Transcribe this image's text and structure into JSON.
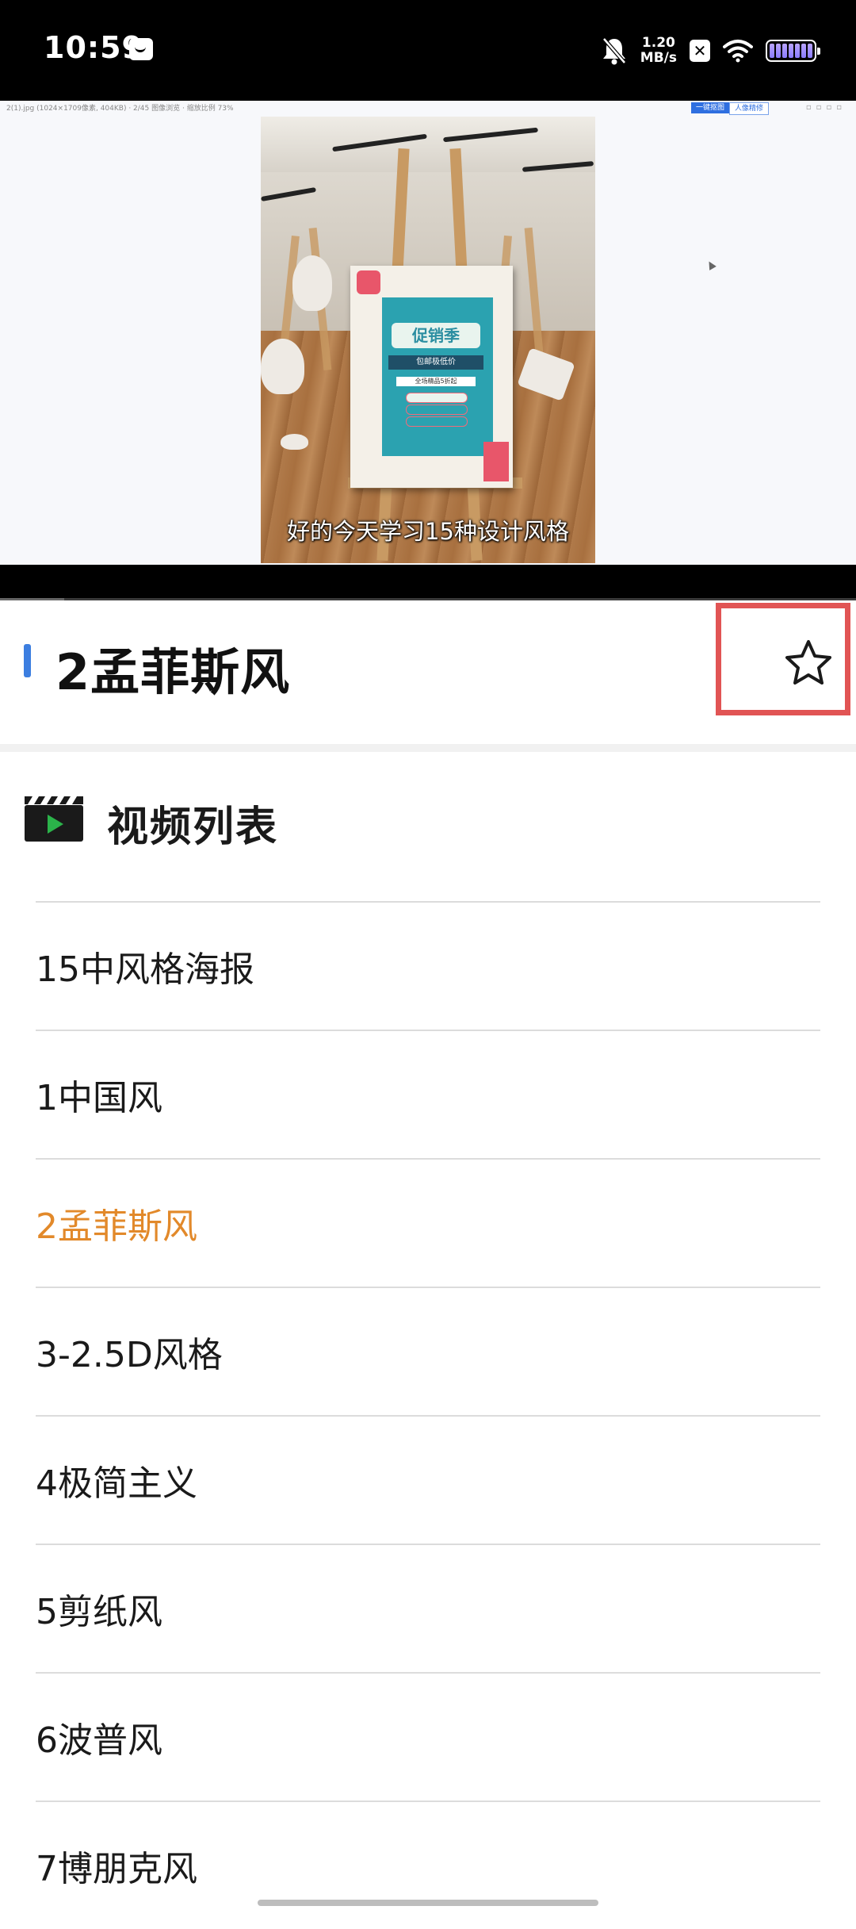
{
  "status_bar": {
    "time": "10:59",
    "net_speed_value": "1.20",
    "net_speed_unit": "MB/s",
    "x_badge": "✕"
  },
  "video": {
    "caption": "好的今天学习15种设计风格",
    "progress_fraction": 0.075,
    "screen_window_text": "2(1).jpg  (1024×1709像素, 404KB) · 2/45 图像浏览 · 缩放比例 73%",
    "screen_button_1": "一键抠图",
    "screen_button_2": "人像精修",
    "poster_title": "促销季",
    "poster_ribbon": "包邮极低价",
    "poster_sub": "全场精品5折起"
  },
  "page": {
    "title": "2孟菲斯风"
  },
  "video_list": {
    "heading": "视频列表",
    "items": [
      {
        "label": "15中风格海报",
        "active": false
      },
      {
        "label": "1中国风",
        "active": false
      },
      {
        "label": "2孟菲斯风",
        "active": true
      },
      {
        "label": "3-2.5D风格",
        "active": false
      },
      {
        "label": "4极简主义",
        "active": false
      },
      {
        "label": "5剪纸风",
        "active": false
      },
      {
        "label": "6波普风",
        "active": false
      },
      {
        "label": "7博朋克风",
        "active": false
      }
    ]
  },
  "colors": {
    "accent_blue": "#3c7ee0",
    "active_item": "#e2892a",
    "highlight_box": "#e15454"
  },
  "icons": {
    "favorite": "star-outline-icon",
    "list_heading": "clapperboard-play-icon"
  }
}
